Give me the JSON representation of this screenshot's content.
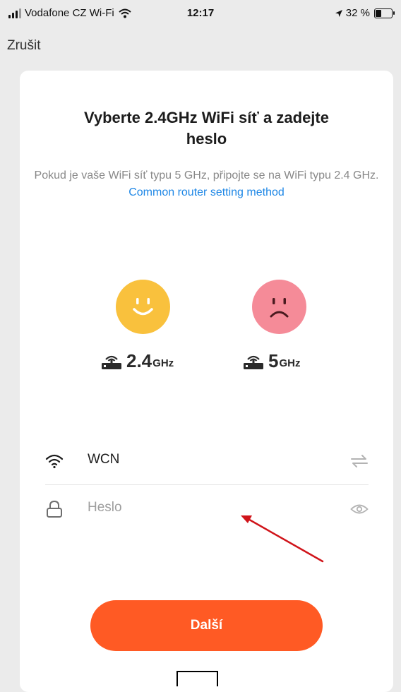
{
  "status_bar": {
    "carrier": "Vodafone CZ Wi-Fi",
    "time": "12:17",
    "battery": "32 %",
    "battery_level": 0.32
  },
  "nav": {
    "cancel_label": "Zrušit"
  },
  "card": {
    "title": "Vyberte 2.4GHz WiFi síť a zadejte heslo",
    "subtitle": "Pokud je vaše WiFi síť typu 5 GHz, připojte se na WiFi typu 2.4 GHz.",
    "link": "Common router setting method",
    "bands": [
      {
        "num": "2.4",
        "unit": "GHz",
        "face": "happy-face-icon"
      },
      {
        "num": "5",
        "unit": "GHz",
        "face": "sad-face-icon"
      }
    ],
    "ssid": {
      "value": "WCN"
    },
    "password": {
      "placeholder": "Heslo"
    },
    "next_label": "Další"
  },
  "colors": {
    "accent": "#ff5a24",
    "link": "#1e87e6",
    "happy": "#f9c13d",
    "sad": "#f58b98",
    "annotation_arrow": "#d0141a"
  }
}
